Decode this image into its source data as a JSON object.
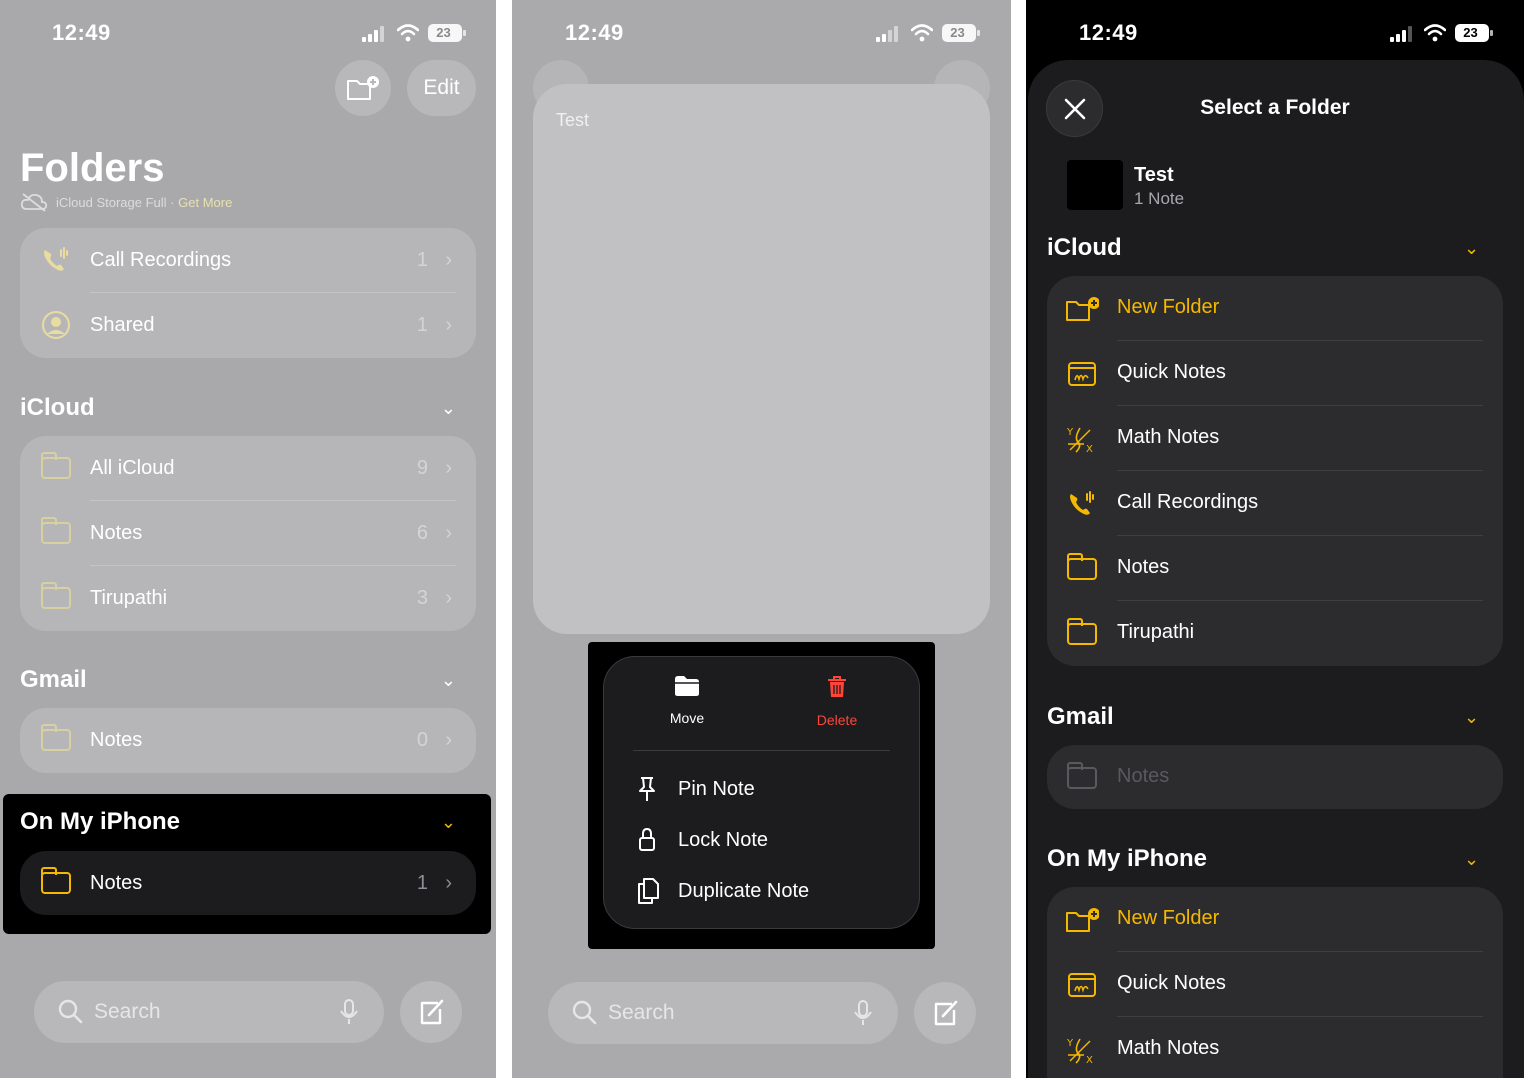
{
  "colors": {
    "accent_yellow": "#f5b800",
    "delete_red": "#ff453a",
    "dimmed_bg": "#a9a9ab",
    "dark_sheet": "#1c1c1e"
  },
  "status_bar": {
    "time": "12:49",
    "battery": "23"
  },
  "panel1": {
    "new_folder_icon": "new-folder-icon",
    "edit_label": "Edit",
    "title": "Folders",
    "storage_text": "iCloud Storage Full · ",
    "storage_link": "Get More",
    "top_items": [
      {
        "label": "Call Recordings",
        "count": "1",
        "icon": "phone-waveform-icon"
      },
      {
        "label": "Shared",
        "count": "1",
        "icon": "person-circle-icon"
      }
    ],
    "icloud": {
      "header": "iCloud",
      "items": [
        {
          "label": "All iCloud",
          "count": "9"
        },
        {
          "label": "Notes",
          "count": "6"
        },
        {
          "label": "Tirupathi",
          "count": "3"
        }
      ]
    },
    "gmail": {
      "header": "Gmail",
      "items": [
        {
          "label": "Notes",
          "count": "0"
        }
      ]
    },
    "on_my_iphone": {
      "header": "On My iPhone",
      "items": [
        {
          "label": "Notes",
          "count": "1"
        }
      ]
    },
    "search_placeholder": "Search"
  },
  "panel2": {
    "note_title": "Test",
    "actions": {
      "move": "Move",
      "delete": "Delete"
    },
    "menu_items": [
      "Pin Note",
      "Lock Note",
      "Duplicate Note"
    ],
    "search_placeholder": "Search"
  },
  "panel3": {
    "title": "Select a Folder",
    "note": {
      "name": "Test",
      "count": "1 Note"
    },
    "icloud": {
      "header": "iCloud",
      "items": [
        "New Folder",
        "Quick Notes",
        "Math Notes",
        "Call Recordings",
        "Notes",
        "Tirupathi"
      ]
    },
    "gmail": {
      "header": "Gmail",
      "items": [
        "Notes"
      ]
    },
    "on_my_iphone": {
      "header": "On My iPhone",
      "items": [
        "New Folder",
        "Quick Notes",
        "Math Notes"
      ]
    }
  }
}
